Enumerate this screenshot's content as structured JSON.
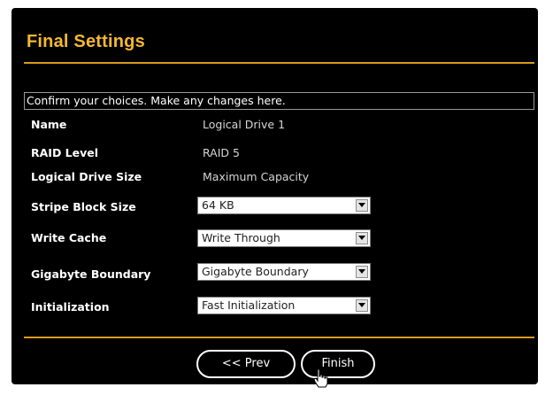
{
  "window": {
    "title": "Final Settings"
  },
  "instruction": "Confirm your choices. Make any changes here.",
  "fields": {
    "name": {
      "label": "Name",
      "value": "Logical Drive 1"
    },
    "raid_level": {
      "label": "RAID Level",
      "value": "RAID 5"
    },
    "drive_size": {
      "label": "Logical Drive Size",
      "value": "Maximum Capacity"
    },
    "stripe_block_size": {
      "label": "Stripe Block Size",
      "selected": "64 KB"
    },
    "write_cache": {
      "label": "Write Cache",
      "selected": "Write Through"
    },
    "gigabyte_boundary": {
      "label": "Gigabyte Boundary",
      "selected": "Gigabyte Boundary"
    },
    "initialization": {
      "label": "Initialization",
      "selected": "Fast Initialization"
    }
  },
  "buttons": {
    "prev": "<< Prev",
    "finish": "Finish"
  },
  "icons": {
    "dropdown": "chevron-down-icon",
    "cursor": "hand-pointer-icon"
  },
  "colors": {
    "accent": "#d89a1e",
    "title": "#f5b830",
    "background": "#000000"
  }
}
